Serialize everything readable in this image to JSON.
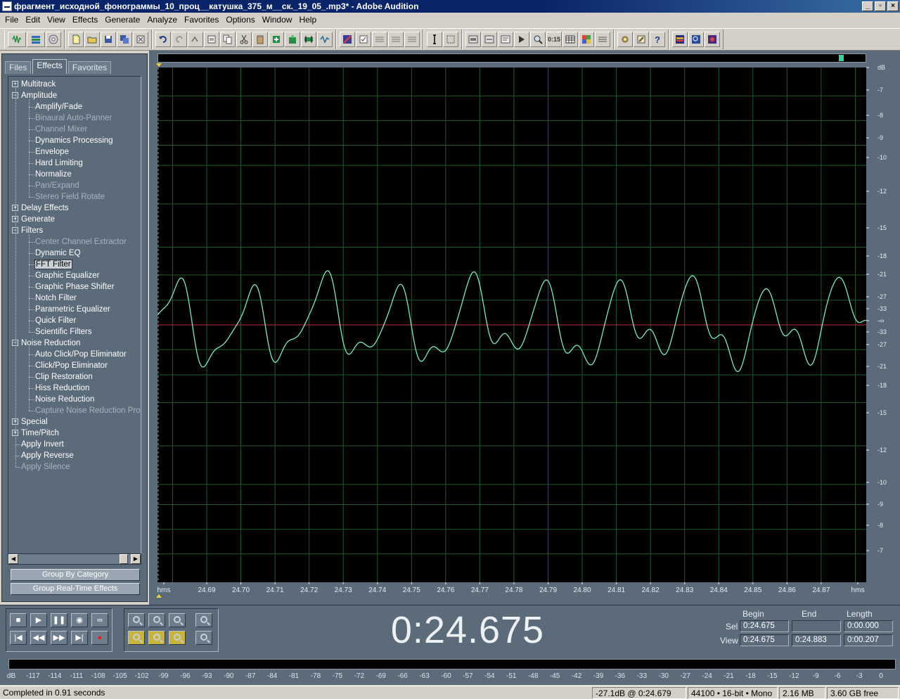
{
  "window": {
    "title": "фрагмент_исходной_фонограммы_10_проц__катушка_375_м__ск._19_05_.mp3* - Adobe Audition"
  },
  "menu": [
    "File",
    "Edit",
    "View",
    "Effects",
    "Generate",
    "Analyze",
    "Favorites",
    "Options",
    "Window",
    "Help"
  ],
  "panel": {
    "tabs": [
      "Files",
      "Effects",
      "Favorites"
    ],
    "active_tab": "Effects",
    "tree": [
      {
        "label": "Multitrack",
        "level": 0,
        "expander": "+",
        "enabled": true
      },
      {
        "label": "Amplitude",
        "level": 0,
        "expander": "-",
        "enabled": true
      },
      {
        "label": "Amplify/Fade",
        "level": 1,
        "enabled": true
      },
      {
        "label": "Binaural Auto-Panner",
        "level": 1,
        "enabled": false
      },
      {
        "label": "Channel Mixer",
        "level": 1,
        "enabled": false
      },
      {
        "label": "Dynamics Processing",
        "level": 1,
        "enabled": true
      },
      {
        "label": "Envelope",
        "level": 1,
        "enabled": true
      },
      {
        "label": "Hard Limiting",
        "level": 1,
        "enabled": true
      },
      {
        "label": "Normalize",
        "level": 1,
        "enabled": true
      },
      {
        "label": "Pan/Expand",
        "level": 1,
        "enabled": false
      },
      {
        "label": "Stereo Field Rotate",
        "level": 1,
        "enabled": false
      },
      {
        "label": "Delay Effects",
        "level": 0,
        "expander": "+",
        "enabled": true
      },
      {
        "label": "Generate",
        "level": 0,
        "expander": "+",
        "enabled": true
      },
      {
        "label": "Filters",
        "level": 0,
        "expander": "-",
        "enabled": true
      },
      {
        "label": "Center Channel Extractor",
        "level": 1,
        "enabled": false
      },
      {
        "label": "Dynamic EQ",
        "level": 1,
        "enabled": true
      },
      {
        "label": "FFT Filter",
        "level": 1,
        "enabled": true,
        "selected": true
      },
      {
        "label": "Graphic Equalizer",
        "level": 1,
        "enabled": true
      },
      {
        "label": "Graphic Phase Shifter",
        "level": 1,
        "enabled": true
      },
      {
        "label": "Notch Filter",
        "level": 1,
        "enabled": true
      },
      {
        "label": "Parametric Equalizer",
        "level": 1,
        "enabled": true
      },
      {
        "label": "Quick Filter",
        "level": 1,
        "enabled": true
      },
      {
        "label": "Scientific Filters",
        "level": 1,
        "enabled": true
      },
      {
        "label": "Noise Reduction",
        "level": 0,
        "expander": "-",
        "enabled": true
      },
      {
        "label": "Auto Click/Pop Eliminator",
        "level": 1,
        "enabled": true
      },
      {
        "label": "Click/Pop Eliminator",
        "level": 1,
        "enabled": true
      },
      {
        "label": "Clip Restoration",
        "level": 1,
        "enabled": true
      },
      {
        "label": "Hiss Reduction",
        "level": 1,
        "enabled": true
      },
      {
        "label": "Noise Reduction",
        "level": 1,
        "enabled": true
      },
      {
        "label": "Capture Noise Reduction Prof",
        "level": 1,
        "enabled": false
      },
      {
        "label": "Special",
        "level": 0,
        "expander": "+",
        "enabled": true
      },
      {
        "label": "Time/Pitch",
        "level": 0,
        "expander": "+",
        "enabled": true
      },
      {
        "label": "Apply Invert",
        "level": 0,
        "enabled": true
      },
      {
        "label": "Apply Reverse",
        "level": 0,
        "enabled": true
      },
      {
        "label": "Apply Silence",
        "level": 0,
        "enabled": false
      }
    ],
    "buttons": {
      "group_by_category": "Group By Category",
      "group_realtime": "Group Real-Time Effects"
    }
  },
  "waveform": {
    "db_labels": [
      "dB",
      "-7",
      "-8",
      "-9",
      "-10",
      "-12",
      "-15",
      "-18",
      "-21",
      "-27",
      "-33",
      "-∞",
      "-33",
      "-27",
      "-21",
      "-18",
      "-15",
      "-12",
      "-10",
      "-9",
      "-8",
      "-7"
    ],
    "time_labels": [
      "hms",
      "24.69",
      "24.70",
      "24.71",
      "24.72",
      "24.73",
      "24.74",
      "24.75",
      "24.76",
      "24.77",
      "24.78",
      "24.79",
      "24.80",
      "24.81",
      "24.82",
      "24.83",
      "24.84",
      "24.85",
      "24.86",
      "24.87",
      "hms"
    ],
    "colors": {
      "wave": "#7fe8c4",
      "grid": "#1f5a2a",
      "center": "#c03030",
      "background": "#000000"
    }
  },
  "transport": {
    "time": "0:24.675",
    "selection": {
      "headers": [
        "Begin",
        "End",
        "Length"
      ],
      "sel_label": "Sel",
      "view_label": "View",
      "sel": [
        "0:24.675",
        "",
        "0:00.000"
      ],
      "view": [
        "0:24.675",
        "0:24.883",
        "0:00.207"
      ]
    }
  },
  "meter": {
    "ticks": [
      "dB",
      "-117",
      "-114",
      "-111",
      "-108",
      "-105",
      "-102",
      "-99",
      "-96",
      "-93",
      "-90",
      "-87",
      "-84",
      "-81",
      "-78",
      "-75",
      "-72",
      "-69",
      "-66",
      "-63",
      "-60",
      "-57",
      "-54",
      "-51",
      "-48",
      "-45",
      "-42",
      "-39",
      "-36",
      "-33",
      "-30",
      "-27",
      "-24",
      "-21",
      "-18",
      "-15",
      "-12",
      "-9",
      "-6",
      "-3",
      "0"
    ]
  },
  "status": {
    "message": "Completed in 0.91 seconds",
    "level": "-27.1dB @   0:24.679",
    "format": "44100 • 16-bit • Mono",
    "size": "2.16 MB",
    "free": "3.60 GB free"
  }
}
